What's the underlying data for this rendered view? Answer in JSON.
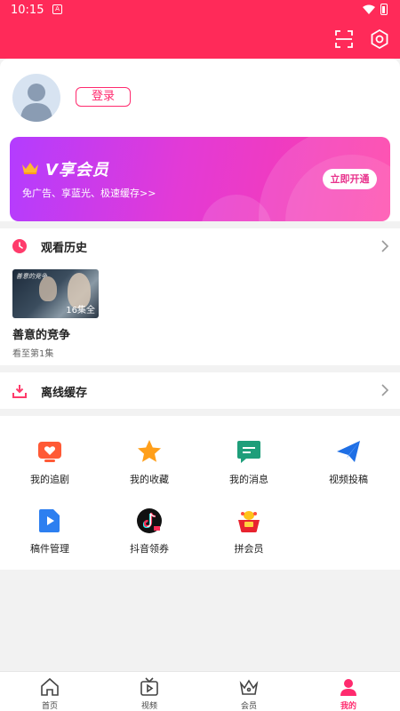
{
  "status_bar": {
    "time": "10:15",
    "notif_glyph": "A",
    "icons": [
      "wifi-icon",
      "battery-icon"
    ]
  },
  "header": {
    "icons": [
      "scan-icon",
      "settings-icon"
    ]
  },
  "profile": {
    "login_label": "登录"
  },
  "vip": {
    "title": "V享会员",
    "description": "免广告、享蓝光、极速缓存>>",
    "button_label": "立即开通"
  },
  "history": {
    "title": "观看历史",
    "item": {
      "thumb_caption": "善意的竞争",
      "badge": "16集全",
      "title": "善意的竞争",
      "progress": "看至第1集"
    }
  },
  "cache": {
    "title": "离线缓存"
  },
  "grid": [
    {
      "label": "我的追剧",
      "icon": "tv-heart-icon"
    },
    {
      "label": "我的收藏",
      "icon": "star-icon"
    },
    {
      "label": "我的消息",
      "icon": "message-icon"
    },
    {
      "label": "视频投稿",
      "icon": "paper-plane-icon"
    },
    {
      "label": "稿件管理",
      "icon": "document-play-icon"
    },
    {
      "label": "抖音领券",
      "icon": "douyin-icon"
    },
    {
      "label": "拼会员",
      "icon": "vip-pot-icon"
    }
  ],
  "nav": [
    {
      "label": "首页",
      "icon": "home-icon",
      "active": false
    },
    {
      "label": "视频",
      "icon": "video-icon",
      "active": false
    },
    {
      "label": "会员",
      "icon": "crown-icon",
      "active": false
    },
    {
      "label": "我的",
      "icon": "person-icon",
      "active": true
    }
  ],
  "colors": {
    "brand": "#ff2a59",
    "accent": "#ff2a6e",
    "vip_start": "#b33cff",
    "vip_end": "#ff3da6"
  }
}
